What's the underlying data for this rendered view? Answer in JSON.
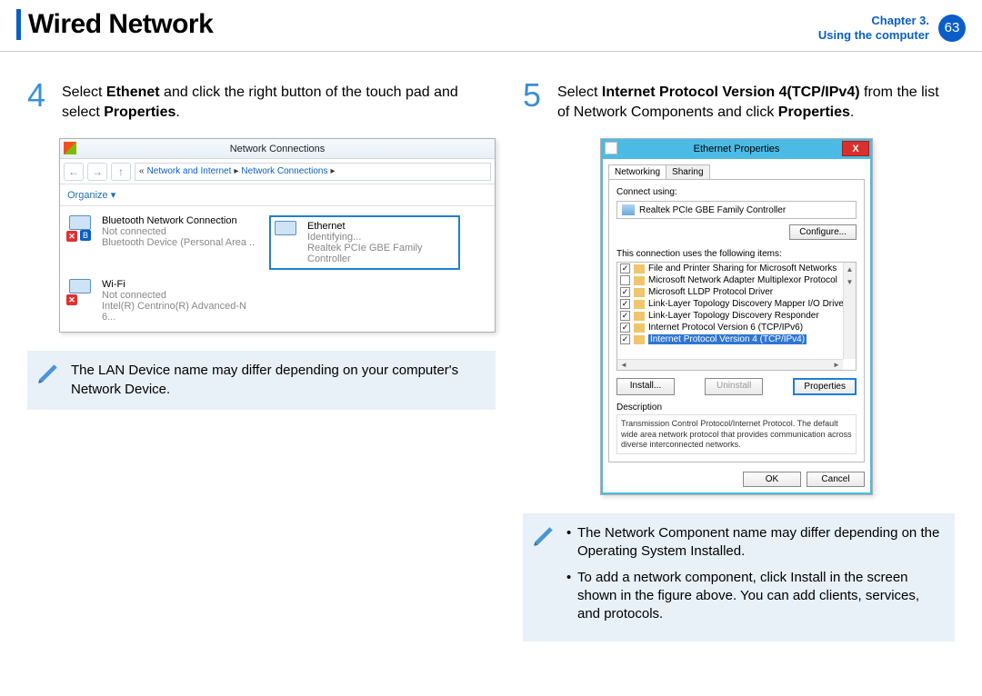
{
  "header": {
    "title": "Wired Network",
    "chapter_label": "Chapter 3.",
    "chapter_sub": "Using the computer",
    "page_number": "63"
  },
  "steps": {
    "step4": {
      "num": "4",
      "prefix": "Select ",
      "bold1": "Ethenet",
      "mid": " and click the right button of the touch pad and select ",
      "bold2": "Properties",
      "suffix": "."
    },
    "step5": {
      "num": "5",
      "prefix": "Select ",
      "bold1": "Internet Protocol Version 4(TCP/IPv4)",
      "mid": " from the list of Network Components and click ",
      "bold2": "Properties",
      "suffix": "."
    }
  },
  "note_left": "The LAN Device name may differ depending on your computer's Network Device.",
  "note_right": {
    "bullet1": "The Network Component name may differ depending on the Operating System Installed.",
    "bullet2": "To add a network component, click Install in the screen shown in the figure above. You can add clients, services, and protocols."
  },
  "screenshot1": {
    "title": "Network Connections",
    "breadcrumb_prefix": "«",
    "crumb1": "Network and Internet",
    "crumb2": "Network Connections",
    "organize": "Organize ▾",
    "items": {
      "bt": {
        "name": "Bluetooth Network Connection",
        "status": "Not connected",
        "device": "Bluetooth Device (Personal Area .."
      },
      "eth": {
        "name": "Ethernet",
        "status": "Identifying...",
        "device": "Realtek PCIe GBE Family Controller"
      },
      "wifi": {
        "name": "Wi-Fi",
        "status": "Not connected",
        "device": "Intel(R) Centrino(R) Advanced-N 6..."
      }
    }
  },
  "screenshot2": {
    "title": "Ethernet Properties",
    "tab_networking": "Networking",
    "tab_sharing": "Sharing",
    "connect_using_label": "Connect using:",
    "adapter": "Realtek PCIe GBE Family Controller",
    "configure_btn": "Configure...",
    "list_label": "This connection uses the following items:",
    "items": [
      {
        "checked": true,
        "label": "File and Printer Sharing for Microsoft Networks"
      },
      {
        "checked": false,
        "label": "Microsoft Network Adapter Multiplexor Protocol"
      },
      {
        "checked": true,
        "label": "Microsoft LLDP Protocol Driver"
      },
      {
        "checked": true,
        "label": "Link-Layer Topology Discovery Mapper I/O Driver"
      },
      {
        "checked": true,
        "label": "Link-Layer Topology Discovery Responder"
      },
      {
        "checked": true,
        "label": "Internet Protocol Version 6 (TCP/IPv6)"
      },
      {
        "checked": true,
        "label": "Internet Protocol Version 4 (TCP/IPv4)",
        "selected": true
      }
    ],
    "install_btn": "Install...",
    "uninstall_btn": "Uninstall",
    "properties_btn": "Properties",
    "description_head": "Description",
    "description_text": "Transmission Control Protocol/Internet Protocol. The default wide area network protocol that provides communication across diverse interconnected networks.",
    "ok_btn": "OK",
    "cancel_btn": "Cancel"
  }
}
